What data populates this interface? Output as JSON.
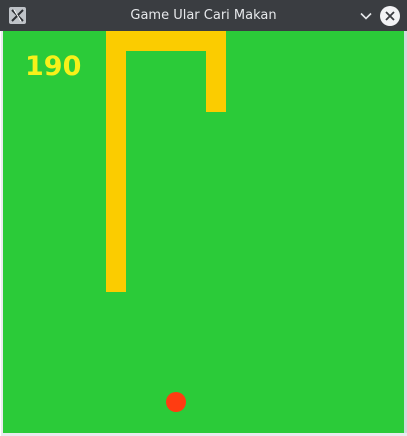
{
  "window": {
    "title": "Game Ular Cari Makan",
    "icon": "x-app-icon",
    "controls": {
      "minimize_icon": "chevron-down-icon",
      "close_icon": "close-icon"
    }
  },
  "game": {
    "score": "190",
    "colors": {
      "board": "#2bcb39",
      "snake": "#fbcc00",
      "food": "#ff3c11",
      "score": "#f6f11a"
    }
  }
}
